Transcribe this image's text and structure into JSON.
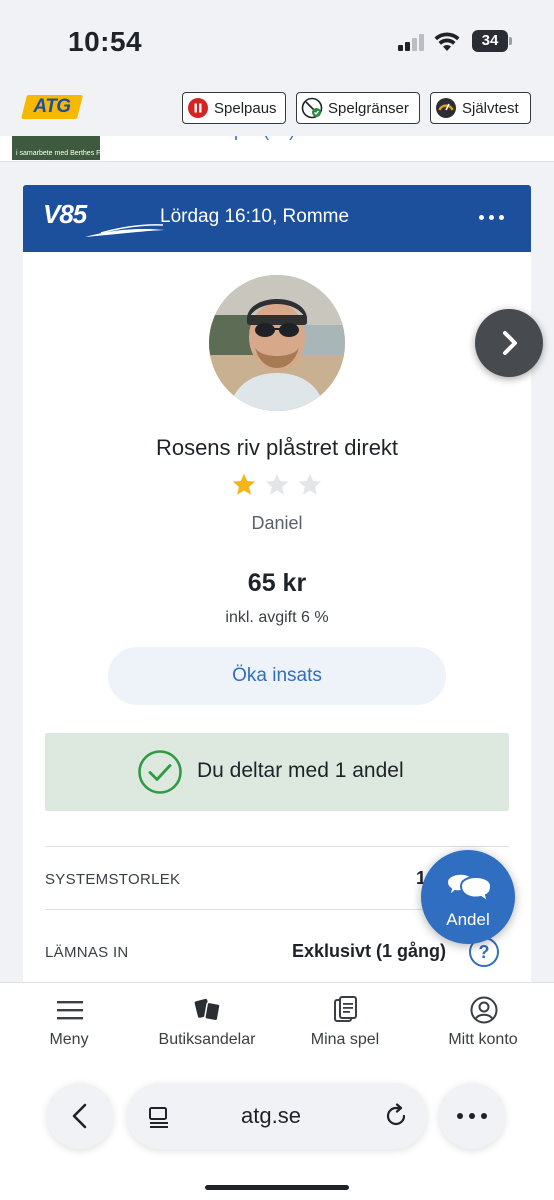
{
  "status_bar": {
    "time": "10:54",
    "battery": "34"
  },
  "header": {
    "logo": "ATG",
    "buttons": [
      {
        "label": "Spelpaus",
        "icon": "pause-icon",
        "color": "#d42323"
      },
      {
        "label": "Spelgränser",
        "icon": "limits-icon",
        "color": "#2a8a3a"
      },
      {
        "label": "Självtest",
        "icon": "gauge-icon",
        "color": "#f0a000"
      }
    ]
  },
  "card": {
    "game": "V85",
    "title": "Lördag 16:10, Romme",
    "header_color": "#1c4f9c",
    "team_name": "Rosens riv plåstret direkt",
    "rating": {
      "value": 1,
      "max": 3
    },
    "user": "Daniel",
    "price": "65 kr",
    "fee": "inkl. avgift 6 %",
    "increase_button": "Öka insats",
    "joined_text": "Du deltar med 1 andel",
    "rows": [
      {
        "label": "SYSTEMSTORLEK",
        "value": "1"
      },
      {
        "label": "LÄMNAS IN",
        "value": "Exklusivt (1 gång)"
      }
    ]
  },
  "floating": {
    "andel_label": "Andel"
  },
  "bottom_nav": {
    "items": [
      {
        "label": "Meny",
        "icon": "menu-icon"
      },
      {
        "label": "Butiksandelar",
        "icon": "cards-icon"
      },
      {
        "label": "Mina spel",
        "icon": "documents-icon"
      },
      {
        "label": "Mitt konto",
        "icon": "account-icon"
      }
    ]
  },
  "browser": {
    "url": "atg.se"
  },
  "colors": {
    "accent": "#2f6ec0",
    "success": "#dde9df",
    "success_icon": "#2f9a44"
  }
}
